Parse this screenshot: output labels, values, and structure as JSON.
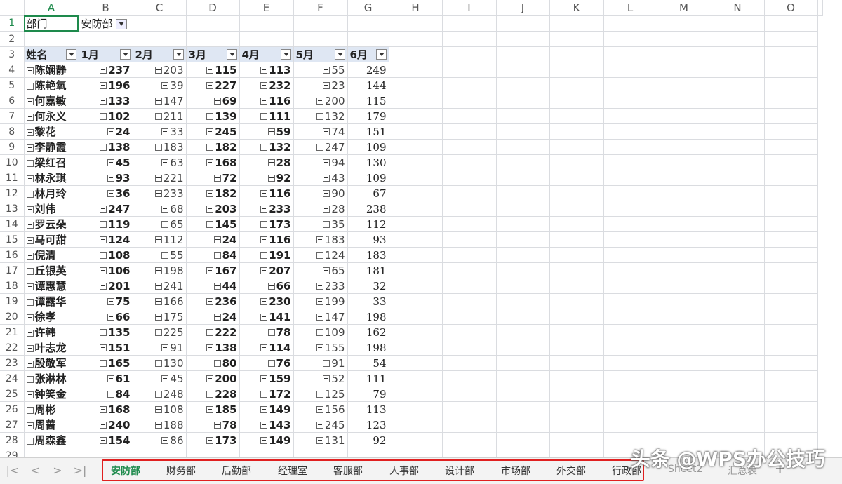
{
  "columns": [
    "A",
    "B",
    "C",
    "D",
    "E",
    "F",
    "G",
    "H",
    "I",
    "J",
    "K",
    "L",
    "M",
    "N",
    "O"
  ],
  "selected_cell": "A1",
  "row1": {
    "label": "部门",
    "value": "安防部"
  },
  "headers": [
    "姓名",
    "1月",
    "2月",
    "3月",
    "4月",
    "5月",
    "6月"
  ],
  "rows": [
    [
      "陈娴静",
      "237",
      "203",
      "115",
      "113",
      "55",
      "249"
    ],
    [
      "陈艳氧",
      "196",
      "39",
      "227",
      "232",
      "23",
      "144"
    ],
    [
      "何嘉敏",
      "133",
      "147",
      "69",
      "116",
      "200",
      "115"
    ],
    [
      "何永义",
      "102",
      "211",
      "139",
      "111",
      "132",
      "179"
    ],
    [
      "黎花",
      "24",
      "33",
      "245",
      "59",
      "74",
      "151"
    ],
    [
      "李静霞",
      "138",
      "183",
      "182",
      "132",
      "247",
      "109"
    ],
    [
      "梁红召",
      "45",
      "63",
      "168",
      "28",
      "94",
      "130"
    ],
    [
      "林永琪",
      "93",
      "221",
      "72",
      "92",
      "43",
      "109"
    ],
    [
      "林月玲",
      "36",
      "233",
      "182",
      "116",
      "90",
      "67"
    ],
    [
      "刘伟",
      "247",
      "68",
      "203",
      "233",
      "28",
      "238"
    ],
    [
      "罗云朵",
      "119",
      "65",
      "145",
      "173",
      "35",
      "112"
    ],
    [
      "马可甜",
      "124",
      "112",
      "24",
      "116",
      "183",
      "93"
    ],
    [
      "倪清",
      "108",
      "55",
      "84",
      "191",
      "124",
      "183"
    ],
    [
      "丘银英",
      "106",
      "198",
      "167",
      "207",
      "65",
      "181"
    ],
    [
      "谭惠慧",
      "201",
      "241",
      "44",
      "66",
      "233",
      "32"
    ],
    [
      "谭露华",
      "75",
      "166",
      "236",
      "230",
      "199",
      "33"
    ],
    [
      "徐孝",
      "66",
      "175",
      "24",
      "141",
      "147",
      "198"
    ],
    [
      "许韩",
      "135",
      "225",
      "222",
      "78",
      "109",
      "162"
    ],
    [
      "叶志龙",
      "151",
      "91",
      "138",
      "114",
      "155",
      "198"
    ],
    [
      "殷敬军",
      "165",
      "130",
      "80",
      "76",
      "91",
      "54"
    ],
    [
      "张淋林",
      "61",
      "45",
      "200",
      "159",
      "52",
      "111"
    ],
    [
      "钟笑金",
      "84",
      "248",
      "228",
      "172",
      "125",
      "79"
    ],
    [
      "周彬",
      "168",
      "108",
      "185",
      "149",
      "156",
      "113"
    ],
    [
      "周蔷",
      "240",
      "188",
      "78",
      "143",
      "245",
      "123"
    ],
    [
      "周森鑫",
      "154",
      "86",
      "173",
      "149",
      "131",
      "92"
    ]
  ],
  "last_row_number": "29",
  "sheet_tabs": [
    "安防部",
    "财务部",
    "后勤部",
    "经理室",
    "客服部",
    "人事部",
    "设计部",
    "市场部",
    "外交部",
    "行政部"
  ],
  "extra_tabs": [
    "Sheet2",
    "汇总表"
  ],
  "add_sheet": "+",
  "nav": {
    "first": "|<",
    "prev": "<",
    "next": ">",
    "last": ">|"
  },
  "watermark": "头条 @WPS办公技巧"
}
